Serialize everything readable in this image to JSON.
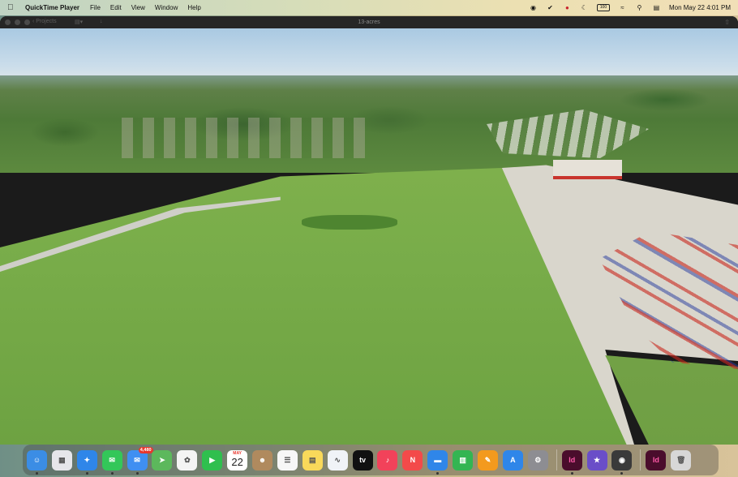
{
  "menubar": {
    "app_name": "QuickTime Player",
    "menus": [
      "File",
      "Edit",
      "View",
      "Window",
      "Help"
    ],
    "battery_label": "100",
    "datetime": "Mon May 22  4:01 PM"
  },
  "window": {
    "title": "13-acres",
    "projects_label": "Projects"
  },
  "dock": {
    "mail_badge": "4,480",
    "calendar_month": "MAY",
    "calendar_day": "22",
    "apps": [
      {
        "name": "Finder",
        "glyph": "☺",
        "color": "#3b8de5"
      },
      {
        "name": "Launchpad",
        "glyph": "▦",
        "color": "#e6e6ea"
      },
      {
        "name": "Safari",
        "glyph": "✦",
        "color": "#2f86e9"
      },
      {
        "name": "Messages",
        "glyph": "✉",
        "color": "#33c759"
      },
      {
        "name": "Mail",
        "glyph": "✉",
        "color": "#3f8ff2"
      },
      {
        "name": "Maps",
        "glyph": "➤",
        "color": "#5cb85c"
      },
      {
        "name": "Photos",
        "glyph": "✿",
        "color": "#f4f4f4"
      },
      {
        "name": "FaceTime",
        "glyph": "▶",
        "color": "#2fbf4e"
      },
      {
        "name": "Calendar",
        "glyph": "",
        "color": "#ffffff"
      },
      {
        "name": "Contacts",
        "glyph": "☻",
        "color": "#b08a5e"
      },
      {
        "name": "Reminders",
        "glyph": "☰",
        "color": "#f7f7f7"
      },
      {
        "name": "Notes",
        "glyph": "▤",
        "color": "#f9d95a"
      },
      {
        "name": "Freeform",
        "glyph": "∿",
        "color": "#f0f3f7"
      },
      {
        "name": "Apple TV",
        "glyph": "tv",
        "color": "#111111"
      },
      {
        "name": "Music",
        "glyph": "♪",
        "color": "#f2425a"
      },
      {
        "name": "News",
        "glyph": "N",
        "color": "#f34a4a"
      },
      {
        "name": "Keynote",
        "glyph": "▬",
        "color": "#2f86e9"
      },
      {
        "name": "Numbers",
        "glyph": "▥",
        "color": "#33b552"
      },
      {
        "name": "Pages",
        "glyph": "✎",
        "color": "#f39a1e"
      },
      {
        "name": "App Store",
        "glyph": "A",
        "color": "#2f86e9"
      },
      {
        "name": "System Settings",
        "glyph": "⚙",
        "color": "#8d8d92"
      },
      {
        "name": "InDesign",
        "glyph": "Id",
        "color": "#4a0d2c"
      },
      {
        "name": "iMovie",
        "glyph": "★",
        "color": "#6a4ec8"
      },
      {
        "name": "QuickTime Player",
        "glyph": "◉",
        "color": "#3a3a3a"
      },
      {
        "name": "InDesign Document",
        "glyph": "Id",
        "color": "#4a0d2c"
      },
      {
        "name": "Trash",
        "glyph": "🗑",
        "color": "#d7d7d7"
      }
    ]
  }
}
